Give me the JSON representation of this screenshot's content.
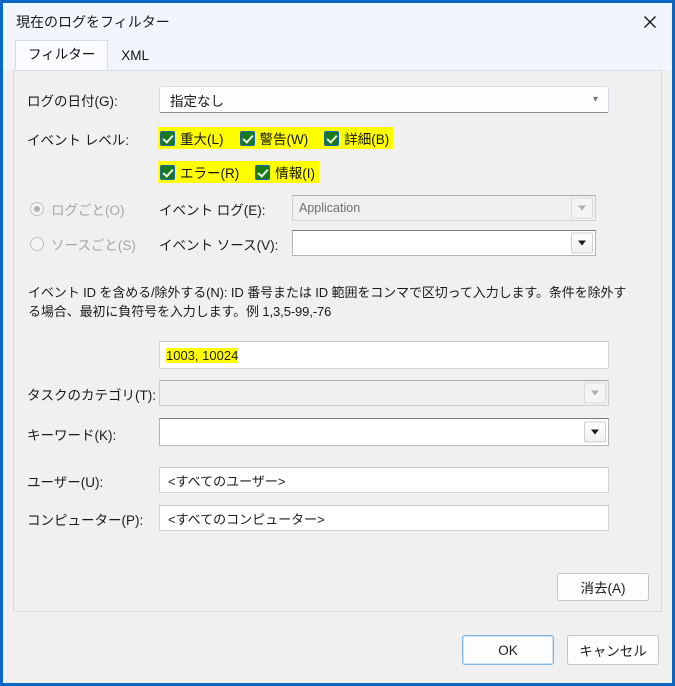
{
  "window": {
    "title": "現在のログをフィルター",
    "close_icon": "close-icon"
  },
  "tabs": [
    {
      "label": "フィルター",
      "active": true
    },
    {
      "label": "XML",
      "active": false
    }
  ],
  "form": {
    "log_date": {
      "label": "ログの日付(G):",
      "value": "指定なし"
    },
    "event_level": {
      "label": "イベント レベル:",
      "options": [
        {
          "label": "重大(L)",
          "checked": true
        },
        {
          "label": "警告(W)",
          "checked": true
        },
        {
          "label": "詳細(B)",
          "checked": true
        },
        {
          "label": "エラー(R)",
          "checked": true
        },
        {
          "label": "情報(I)",
          "checked": true
        }
      ]
    },
    "by_log_radio": {
      "label": "ログごと(O)",
      "selected": true,
      "disabled": true
    },
    "by_source_radio": {
      "label": "ソースごと(S)",
      "selected": false,
      "disabled": true
    },
    "event_log": {
      "label": "イベント ログ(E):",
      "value": "Application",
      "disabled": true
    },
    "event_source": {
      "label": "イベント ソース(V):",
      "value": "",
      "disabled": false
    },
    "event_id": {
      "help": "イベント ID を含める/除外する(N): ID 番号または ID 範囲をコンマで区切って入力します。条件を除外する場合、最初に負符号を入力します。例 1,3,5-99,-76",
      "value": "1003, 10024"
    },
    "task_category": {
      "label": "タスクのカテゴリ(T):",
      "value": "",
      "disabled": true
    },
    "keywords": {
      "label": "キーワード(K):",
      "value": "",
      "disabled": false
    },
    "user": {
      "label": "ユーザー(U):",
      "value": "<すべてのユーザー>"
    },
    "computer": {
      "label": "コンピューター(P):",
      "value": "<すべてのコンピューター>"
    }
  },
  "buttons": {
    "clear": "消去(A)",
    "ok": "OK",
    "cancel": "キャンセル"
  },
  "colors": {
    "window_border": "#0a68c4",
    "highlight": "#ffff00",
    "checkbox_fill": "#1a7a1a",
    "checkbox_border": "#1565c0",
    "title_bar": "#f2f6fc",
    "dialog_bg": "#f0f0f0"
  }
}
